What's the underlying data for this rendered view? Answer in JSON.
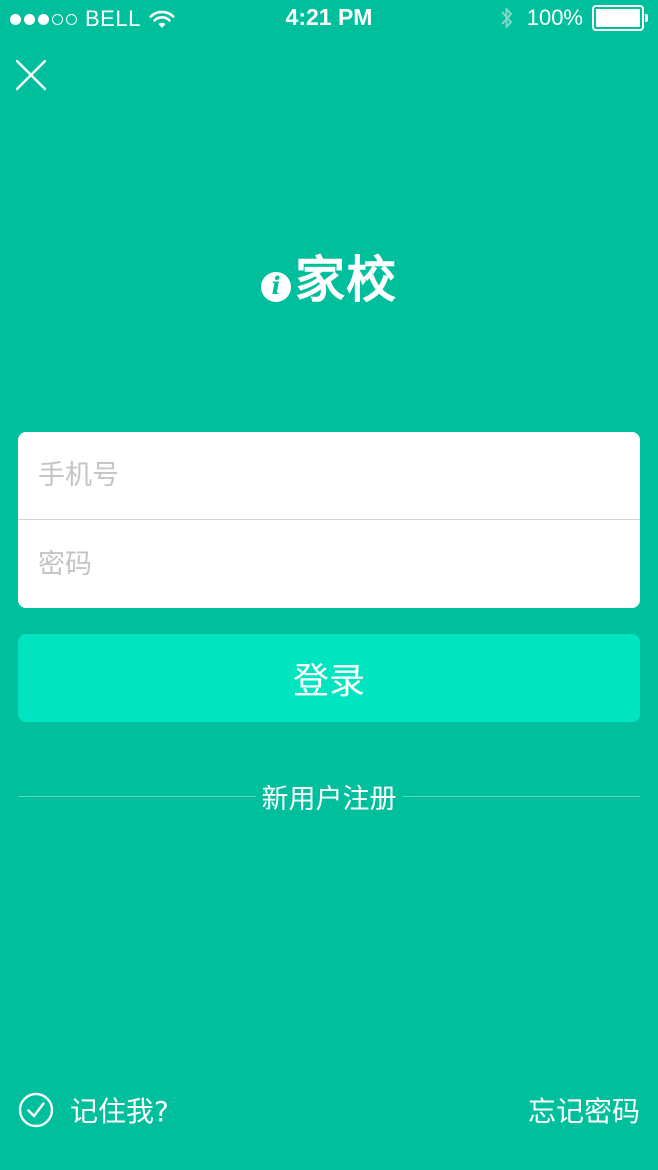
{
  "status_bar": {
    "carrier": "BELL",
    "time": "4:21 PM",
    "battery": "100%",
    "signal_strength": 3,
    "signal_max": 5
  },
  "icons": {
    "close": "close-icon",
    "wifi": "wifi-icon",
    "bluetooth": "bluetooth-icon",
    "check": "check-circle-icon"
  },
  "logo": {
    "mark": "i",
    "text": "家校"
  },
  "form": {
    "phone_placeholder": "手机号",
    "phone_value": "",
    "password_placeholder": "密码",
    "password_value": ""
  },
  "login_label": "登录",
  "register_label": "新用户注册",
  "remember_label": "记住我?",
  "forgot_label": "忘记密码",
  "colors": {
    "background": "#00BF9C",
    "login_button": "#00E5C0",
    "input_background": "#FFFFFF",
    "placeholder": "#C4C4C4"
  }
}
